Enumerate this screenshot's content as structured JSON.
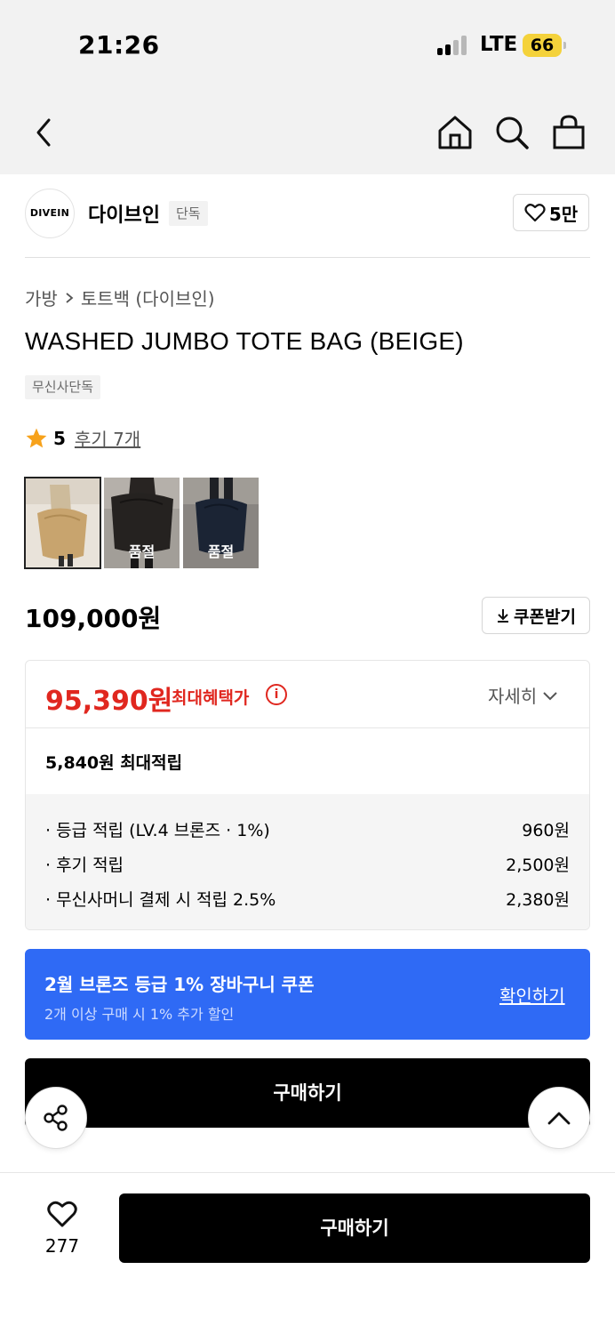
{
  "status_bar": {
    "time": "21:26",
    "network": "LTE",
    "battery": "66"
  },
  "nav": {
    "icons": [
      "back-icon",
      "home-icon",
      "search-icon",
      "shopping-bag-icon"
    ]
  },
  "brand": {
    "logo_text": "DIVEIN",
    "name": "다이브인",
    "badge": "단독",
    "likes": "5만"
  },
  "breadcrumb": {
    "category": "가방",
    "subcategory": "토트백 (다이브인)"
  },
  "product": {
    "title": "WASHED JUMBO TOTE BAG (BEIGE)",
    "tag": "무신사단독",
    "rating": "5",
    "reviews": "후기 7개",
    "thumbnails": [
      {
        "color_name": "beige",
        "sold_out": ""
      },
      {
        "color_name": "black",
        "sold_out": "품절"
      },
      {
        "color_name": "navy",
        "sold_out": "품절"
      }
    ],
    "price": "109,000원",
    "coupon_button": "쿠폰받기"
  },
  "benefit": {
    "max_price": "95,390원",
    "max_label": "최대혜택가",
    "detail_label": "자세히",
    "points_summary": "5,840원 최대적립",
    "rows": [
      {
        "label": "· 등급 적립 (LV.4 브론즈 · 1%)",
        "value": "960원"
      },
      {
        "label": "· 후기 적립",
        "value": "2,500원"
      },
      {
        "label": "· 무신사머니 결제 시 적립 2.5%",
        "value": "2,380원"
      }
    ]
  },
  "banner": {
    "title": "2월 브론즈 등급 1% 장바구니 쿠폰",
    "subtitle": "2개 이상 구매 시 1% 추가 할인",
    "link": "확인하기",
    "color": "#2f6af5"
  },
  "buy_button": "구매하기",
  "bottom_bar": {
    "like_count": "277",
    "buy_label": "구매하기"
  },
  "colors": {
    "sale_red": "#e0271f",
    "accent_blue": "#2f6af5",
    "button_black": "#000000"
  }
}
